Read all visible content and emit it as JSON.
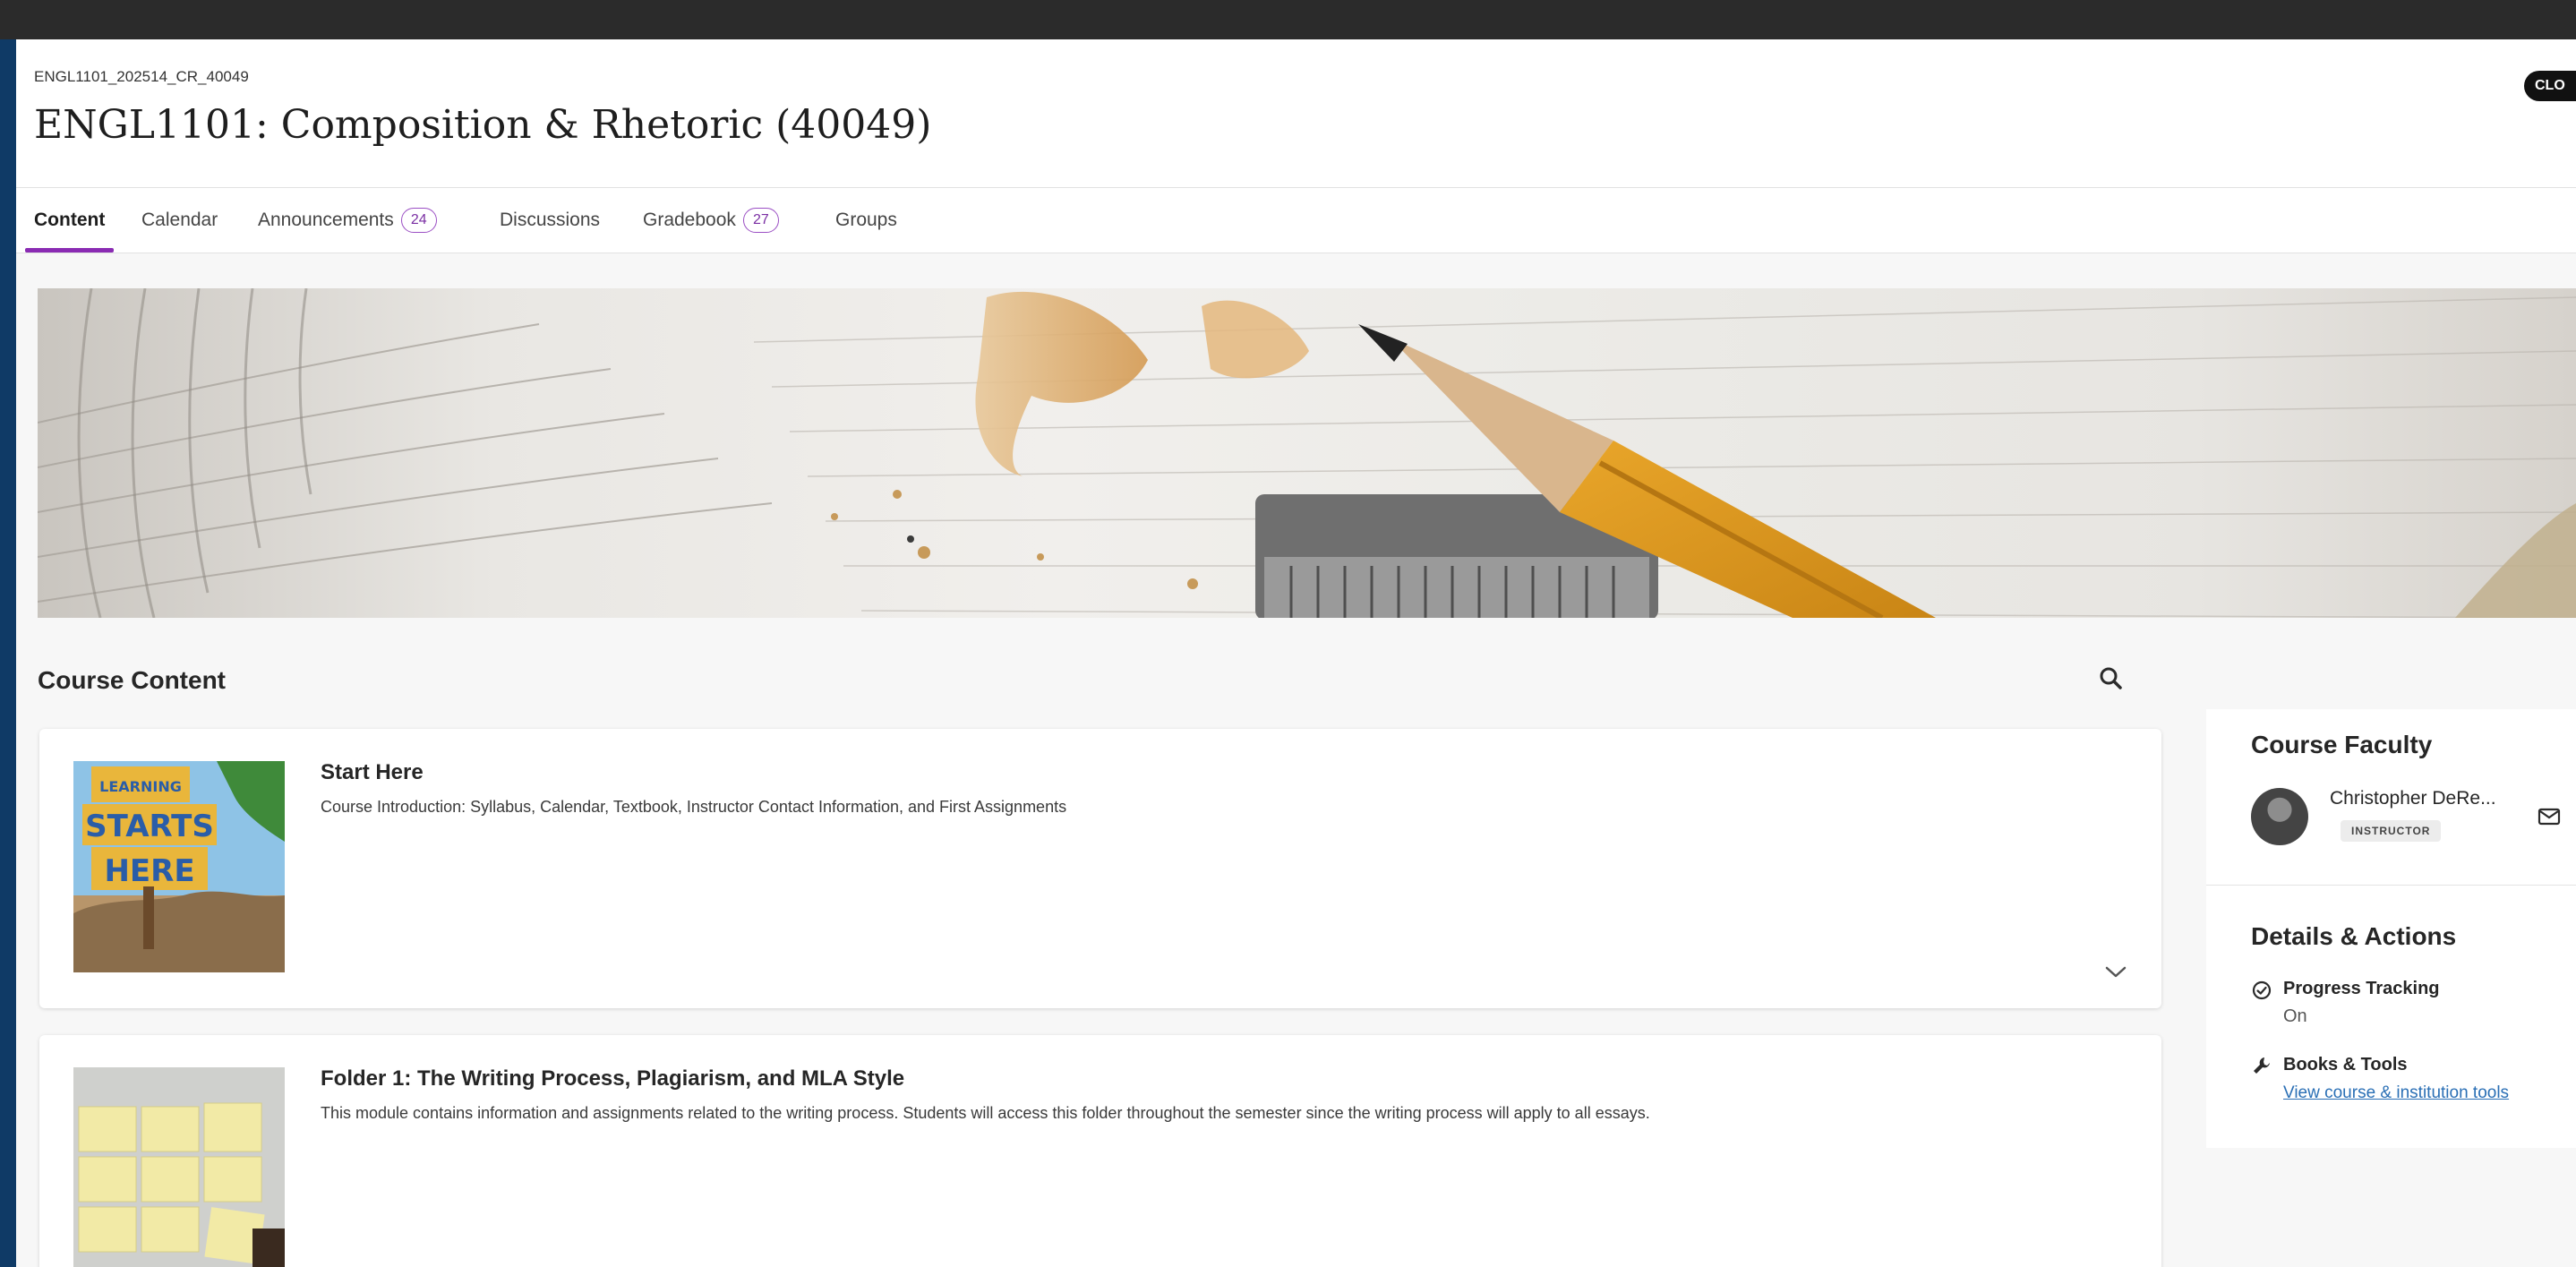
{
  "header": {
    "course_code": "ENGL1101_202514_CR_40049",
    "course_title": "ENGL1101: Composition & Rhetoric (40049)",
    "close_label": "CLO"
  },
  "tabs": [
    {
      "label": "Content",
      "active": true
    },
    {
      "label": "Calendar"
    },
    {
      "label": "Announcements",
      "count": "24"
    },
    {
      "label": "Discussions"
    },
    {
      "label": "Gradebook",
      "count": "27"
    },
    {
      "label": "Groups"
    }
  ],
  "content": {
    "title": "Course Content",
    "items": [
      {
        "title": "Start Here",
        "description": "Course Introduction: Syllabus, Calendar, Textbook, Instructor Contact Information, and First Assignments",
        "thumb_lines": [
          "LEARNING",
          "STARTS",
          "HERE"
        ]
      },
      {
        "title": "Folder 1: The Writing Process, Plagiarism, and MLA Style",
        "description": "This module contains information and assignments related to the writing process. Students will access this folder throughout the semester since the writing process will apply to all essays."
      }
    ]
  },
  "sidebar": {
    "faculty_title": "Course Faculty",
    "faculty_name": "Christopher DeRe...",
    "faculty_role": "INSTRUCTOR",
    "details_title": "Details & Actions",
    "progress_label": "Progress Tracking",
    "progress_value": "On",
    "books_label": "Books & Tools",
    "books_link": "View course & institution tools"
  },
  "colors": {
    "accent": "#8a2bb3",
    "frame": "#0f3a66",
    "link": "#2a6fb5"
  }
}
